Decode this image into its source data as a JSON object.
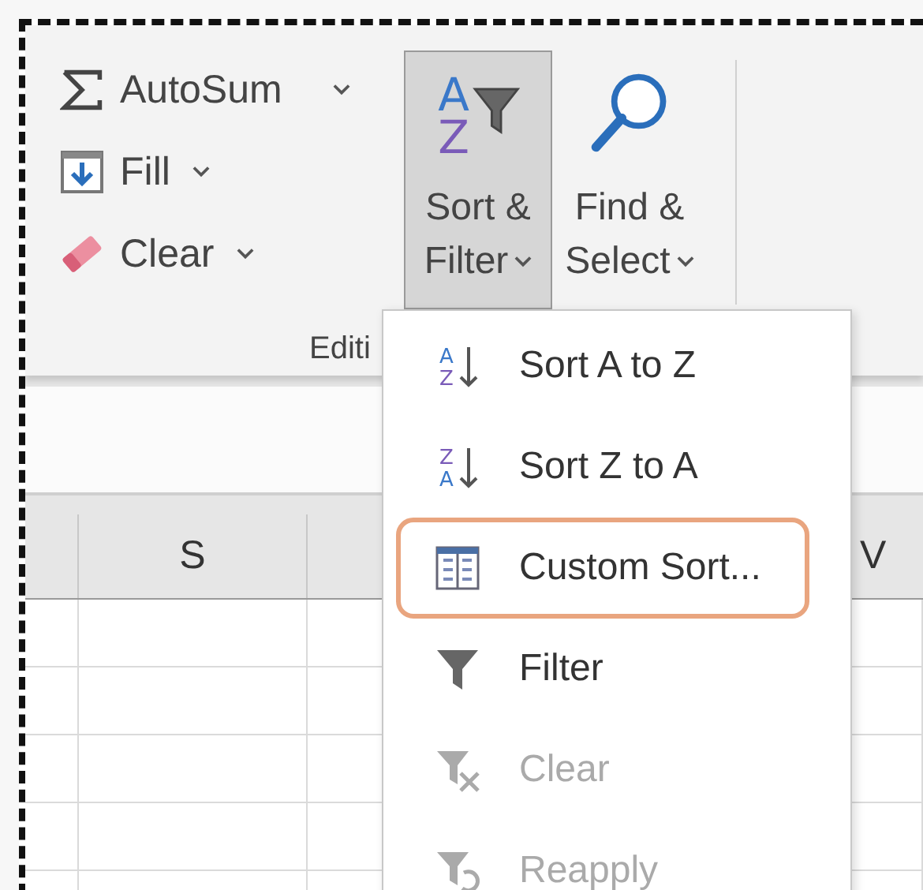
{
  "ribbon": {
    "small_commands": [
      {
        "kind": "autosum",
        "label": "AutoSum",
        "has_dropdown": true
      },
      {
        "kind": "fill",
        "label": "Fill",
        "has_dropdown": true
      },
      {
        "kind": "clear",
        "label": "Clear",
        "has_dropdown": true
      }
    ],
    "large_commands": [
      {
        "kind": "sort-filter",
        "lines": [
          "Sort &",
          "Filter"
        ],
        "icon_text": [
          "A",
          "Z"
        ],
        "selected": true,
        "has_dropdown": true
      },
      {
        "kind": "find-select",
        "lines": [
          "Find &",
          "Select"
        ],
        "selected": false,
        "has_dropdown": true
      }
    ],
    "group_label": "Editi"
  },
  "menu": {
    "items": [
      {
        "kind": "sort",
        "label": "Sort A to Z",
        "icon_text": [
          "A",
          "Z"
        ],
        "disabled": false,
        "highlighted": false
      },
      {
        "kind": "sort",
        "label": "Sort Z to A",
        "icon_text": [
          "Z",
          "A"
        ],
        "disabled": false,
        "highlighted": false
      },
      {
        "kind": "custom-sort",
        "label": "Custom Sort...",
        "disabled": false,
        "highlighted": true
      },
      {
        "kind": "filter",
        "label": "Filter",
        "disabled": false,
        "highlighted": false
      },
      {
        "kind": "clear-filter",
        "label": "Clear",
        "disabled": true,
        "highlighted": false
      },
      {
        "kind": "reapply",
        "label": "Reapply",
        "disabled": true,
        "highlighted": false
      }
    ]
  },
  "sheet": {
    "columns": [
      {
        "label": "S"
      },
      {
        "label": "V"
      }
    ]
  }
}
